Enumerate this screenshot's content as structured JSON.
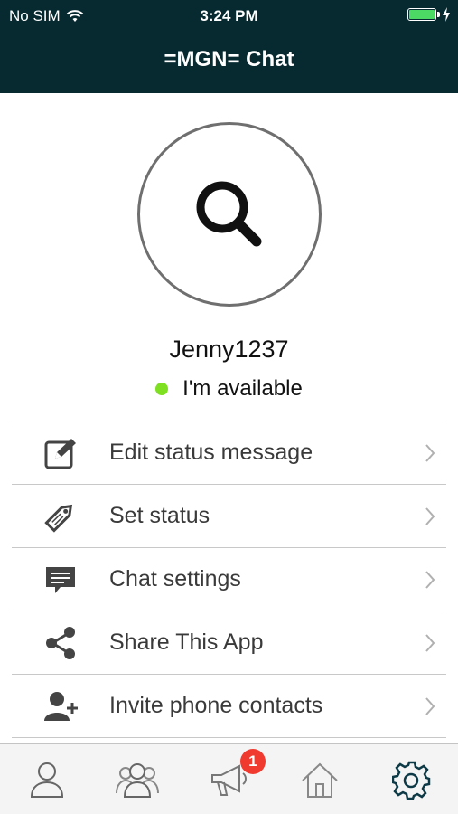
{
  "status_bar": {
    "carrier": "No SIM",
    "time": "3:24 PM"
  },
  "header": {
    "title": "=MGN= Chat"
  },
  "profile": {
    "username": "Jenny1237",
    "status": "I'm available"
  },
  "menu": [
    {
      "label": "Edit status message",
      "icon": "edit-icon"
    },
    {
      "label": "Set status",
      "icon": "tag-icon"
    },
    {
      "label": "Chat settings",
      "icon": "chat-bubble-icon"
    },
    {
      "label": "Share This App",
      "icon": "share-icon"
    },
    {
      "label": "Invite phone contacts",
      "icon": "add-contact-icon"
    }
  ],
  "tabbar": {
    "tabs": [
      "contacts",
      "groups",
      "announcements",
      "home",
      "settings"
    ],
    "announcements_badge": "1"
  },
  "colors": {
    "header_bg": "#062a30",
    "available": "#7ee021",
    "badge": "#f13a2f",
    "battery": "#4cd964"
  }
}
